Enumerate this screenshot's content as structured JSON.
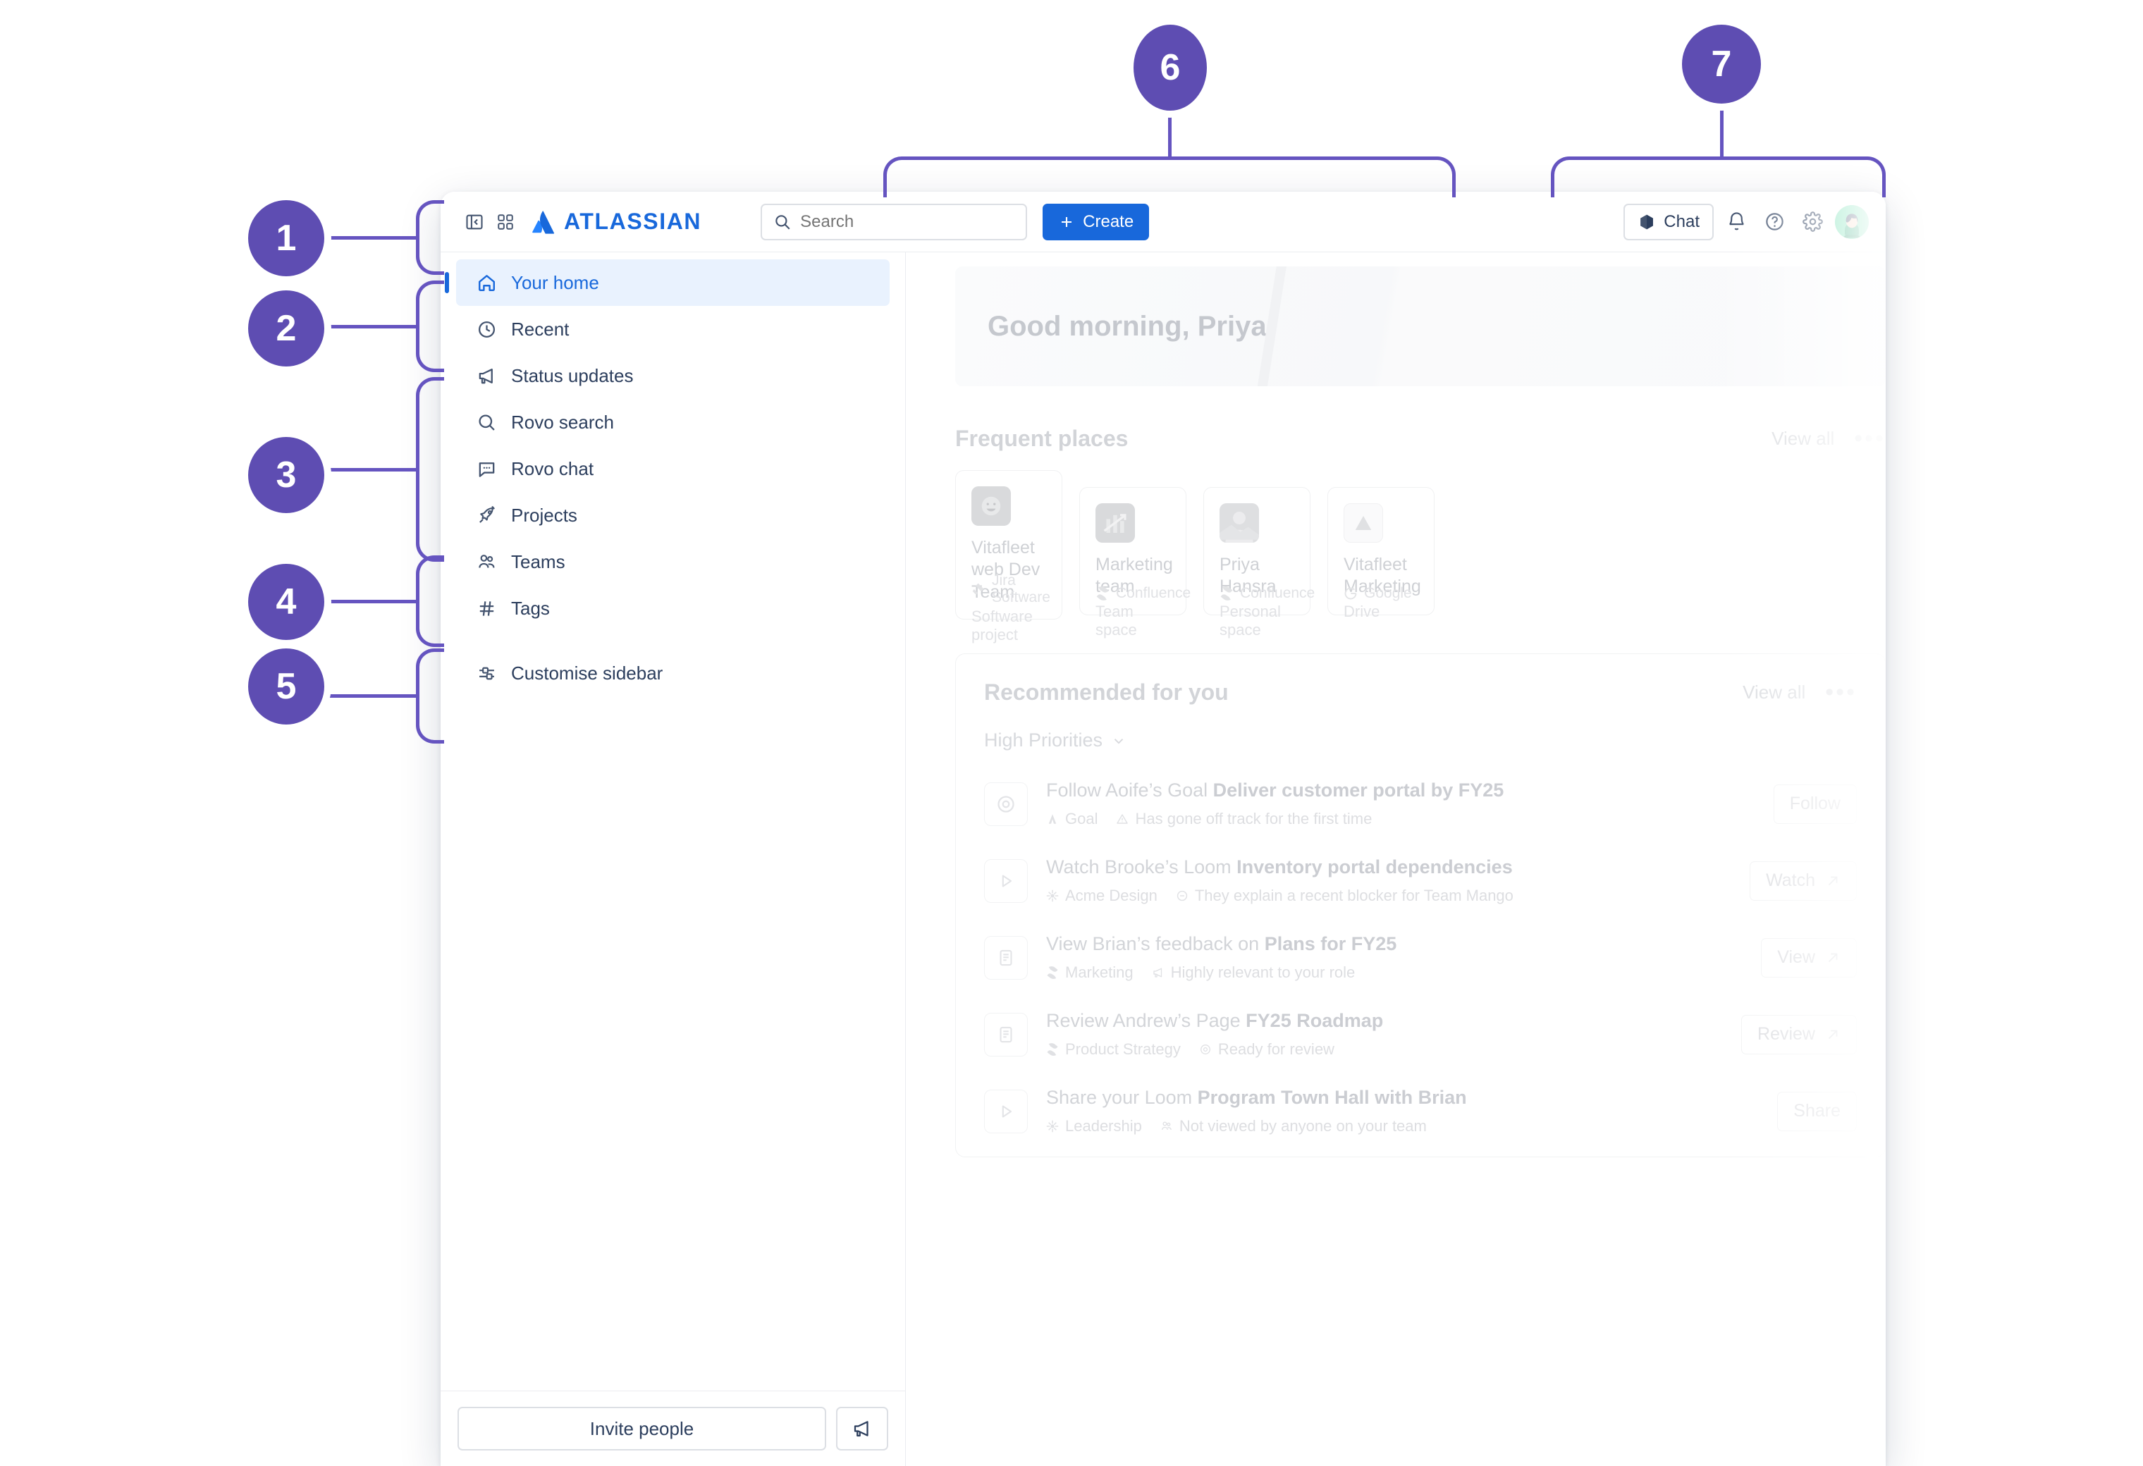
{
  "annotations": {
    "badges": [
      "1",
      "2",
      "3",
      "4",
      "5",
      "6",
      "7"
    ],
    "accent_color": "#5E4DB2",
    "line_color": "#6554C0"
  },
  "topbar": {
    "sidebar_toggle_icon": "panel-collapse-icon",
    "app_switcher_icon": "app-switcher-icon",
    "brand": "ATLASSIAN",
    "search": {
      "placeholder": "Search",
      "value": "",
      "icon": "search-icon"
    },
    "create_label": "Create",
    "create_color": "#1868DB",
    "chat_label": "Chat",
    "notifications_icon": "bell-icon",
    "help_icon": "help-icon",
    "settings_icon": "gear-icon",
    "avatar_icon": "avatar"
  },
  "sidebar": {
    "items": [
      {
        "label": "Your home",
        "icon": "home-icon",
        "active": true
      },
      {
        "label": "Recent",
        "icon": "clock-icon",
        "active": false
      },
      {
        "label": "Status updates",
        "icon": "megaphone-icon",
        "active": false
      },
      {
        "label": "Rovo search",
        "icon": "search-icon",
        "active": false
      },
      {
        "label": "Rovo chat",
        "icon": "chat-bubble-icon",
        "active": false
      },
      {
        "label": "Projects",
        "icon": "rocket-icon",
        "active": false
      },
      {
        "label": "Teams",
        "icon": "people-icon",
        "active": false
      },
      {
        "label": "Tags",
        "icon": "hash-icon",
        "active": false
      }
    ],
    "customise": {
      "label": "Customise sidebar",
      "icon": "sliders-icon"
    },
    "footer": {
      "invite_label": "Invite people",
      "feedback_icon": "megaphone-icon"
    }
  },
  "main": {
    "greeting": "Good morning, Priya",
    "frequent": {
      "title": "Frequent places",
      "view_all": "View all",
      "more_icon": "more-horizontal-icon",
      "cards": [
        {
          "title": "Vitafleet web Dev Team",
          "subtitle": "Software project",
          "source": "Jira Software",
          "source_icon": "jira-icon",
          "avatar_icon": "smiley-avatar-icon"
        },
        {
          "title": "Marketing team",
          "subtitle": "Team space",
          "source": "Confluence",
          "source_icon": "confluence-icon",
          "avatar_icon": "chart-icon"
        },
        {
          "title": "Priya Hansra",
          "subtitle": "Personal space",
          "source": "Confluence",
          "source_icon": "confluence-icon",
          "avatar_icon": "photo-avatar-icon"
        },
        {
          "title": "Vitafleet Marketing",
          "subtitle": "Drive",
          "source": "Google",
          "source_icon": "google-icon",
          "avatar_icon": "drive-icon"
        }
      ]
    },
    "recommended": {
      "title": "Recommended for you",
      "view_all": "View all",
      "more_icon": "more-horizontal-icon",
      "filter_label": "High Priorities",
      "filter_chevron": "chevron-down-icon",
      "rows": [
        {
          "icon": "goal-target-icon",
          "title_prefix": "Follow Aoife’s Goal ",
          "title_bold": "Deliver customer portal by FY25",
          "meta_type": "Goal",
          "meta_type_icon": "atlas-icon",
          "meta_note": "Has gone off track for the first time",
          "meta_note_icon": "warning-icon",
          "action": "Follow",
          "action_icon": ""
        },
        {
          "icon": "play-icon",
          "title_prefix": "Watch Brooke’s Loom ",
          "title_bold": "Inventory portal dependencies",
          "meta_type": "Acme Design",
          "meta_type_icon": "loom-icon",
          "meta_note": "They explain a recent blocker for Team Mango",
          "meta_note_icon": "minus-circle-icon",
          "action": "Watch",
          "action_icon": "arrow-up-right-icon"
        },
        {
          "icon": "page-icon",
          "title_prefix": "View Brian’s feedback on ",
          "title_bold": "Plans for FY25",
          "meta_type": "Marketing",
          "meta_type_icon": "confluence-icon",
          "meta_note": "Highly relevant to your role",
          "meta_note_icon": "megaphone-icon",
          "action": "View",
          "action_icon": "arrow-up-right-icon"
        },
        {
          "icon": "page-icon",
          "title_prefix": "Review Andrew’s Page ",
          "title_bold": "FY25 Roadmap",
          "meta_type": "Product Strategy",
          "meta_type_icon": "confluence-icon",
          "meta_note": "Ready for review",
          "meta_note_icon": "eye-icon",
          "action": "Review",
          "action_icon": "arrow-up-right-icon"
        },
        {
          "icon": "play-icon",
          "title_prefix": "Share your Loom ",
          "title_bold": "Program Town Hall with Brian",
          "meta_type": "Leadership",
          "meta_type_icon": "loom-icon",
          "meta_note": "Not viewed by anyone on your team",
          "meta_note_icon": "people-icon",
          "action": "Share",
          "action_icon": ""
        }
      ]
    }
  }
}
